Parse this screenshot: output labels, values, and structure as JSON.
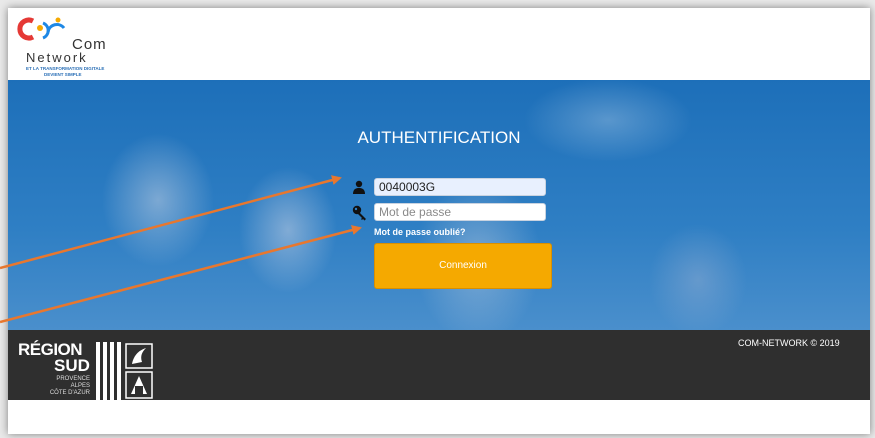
{
  "logo": {
    "word1": "Com",
    "word2": "Network",
    "tagline_line1": "ET LA TRANSFORMATION DIGITALE",
    "tagline_line2": "DEVIENT SIMPLE"
  },
  "auth": {
    "title": "AUTHENTIFICATION",
    "username_value": "0040003G",
    "password_placeholder": "Mot de passe",
    "forgot_link": "Mot de passe oublié?",
    "submit_label": "Connexion"
  },
  "footer": {
    "region_word": "RÉGION",
    "region_sud": "SUD",
    "region_line1": "PROVENCE",
    "region_line2": "ALPES",
    "region_line3": "CÔTE D'AZUR",
    "copyright": "COM-NETWORK © 2019"
  },
  "colors": {
    "hero_blue": "#2f7fc4",
    "button_orange": "#f5a900",
    "footer_dark": "#2f2f2f",
    "annotation_arrow": "#e8772e"
  },
  "icons": [
    "user-icon",
    "key-icon"
  ]
}
